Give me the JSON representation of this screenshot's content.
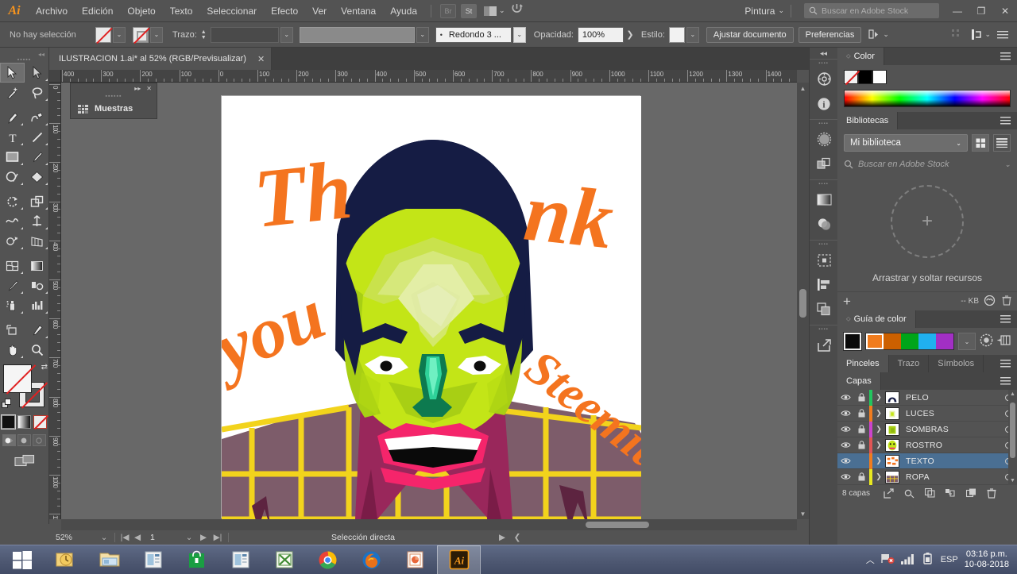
{
  "app": {
    "logo": "Ai",
    "menus": [
      "Archivo",
      "Edición",
      "Objeto",
      "Texto",
      "Seleccionar",
      "Efecto",
      "Ver",
      "Ventana",
      "Ayuda"
    ],
    "bridge_btn": "Br",
    "stock_btn": "St",
    "workspace": "Pintura",
    "stock_search_placeholder": "Buscar en Adobe Stock",
    "window_minimize": "—",
    "window_restore": "❐",
    "window_close": "✕"
  },
  "control_bar": {
    "selection_status": "No hay selección",
    "stroke_label": "Trazo:",
    "stroke_weight": "",
    "brush_definition": "Redondo 3 ...",
    "opacity_label": "Opacidad:",
    "opacity_value": "100%",
    "style_label": "Estilo:",
    "fit_document": "Ajustar documento",
    "preferences": "Preferencias"
  },
  "tools": {
    "items": [
      {
        "name": "selection-tool",
        "label": "Selección",
        "active": true
      },
      {
        "name": "direct-selection-tool",
        "label": "Selección directa",
        "active": false
      },
      {
        "name": "magic-wand-tool",
        "label": "Varita mágica",
        "active": false
      },
      {
        "name": "lasso-tool",
        "label": "Lazo",
        "active": false
      },
      {
        "name": "pen-tool",
        "label": "Pluma",
        "active": false
      },
      {
        "name": "curvature-tool",
        "label": "Curvatura",
        "active": false
      },
      {
        "name": "type-tool",
        "label": "Texto",
        "active": false
      },
      {
        "name": "line-segment-tool",
        "label": "Segmento de línea",
        "active": false
      },
      {
        "name": "rectangle-tool",
        "label": "Rectángulo",
        "active": false
      },
      {
        "name": "paintbrush-tool",
        "label": "Pincel",
        "active": false
      },
      {
        "name": "shaper-tool",
        "label": "Shaper",
        "active": false
      },
      {
        "name": "eraser-tool",
        "label": "Borrador",
        "active": false
      },
      {
        "name": "rotate-tool",
        "label": "Rotar",
        "active": false
      },
      {
        "name": "scale-tool",
        "label": "Escala",
        "active": false
      },
      {
        "name": "width-tool",
        "label": "Anchura",
        "active": false
      },
      {
        "name": "free-transform-tool",
        "label": "Transformación libre",
        "active": false
      },
      {
        "name": "shape-builder-tool",
        "label": "Creador de formas",
        "active": false
      },
      {
        "name": "perspective-grid-tool",
        "label": "Cuadrícula de perspectiva",
        "active": false
      },
      {
        "name": "mesh-tool",
        "label": "Malla",
        "active": false
      },
      {
        "name": "gradient-tool",
        "label": "Degradado",
        "active": false
      },
      {
        "name": "eyedropper-tool",
        "label": "Cuentagotas",
        "active": false
      },
      {
        "name": "blend-tool",
        "label": "Fusión",
        "active": false
      },
      {
        "name": "symbol-sprayer-tool",
        "label": "Rociar símbolos",
        "active": false
      },
      {
        "name": "column-graph-tool",
        "label": "Gráfica de columnas",
        "active": false
      },
      {
        "name": "artboard-tool",
        "label": "Mesa de trabajo",
        "active": false
      },
      {
        "name": "slice-tool",
        "label": "Sector",
        "active": false
      },
      {
        "name": "hand-tool",
        "label": "Mano",
        "active": false
      },
      {
        "name": "zoom-tool",
        "label": "Zoom",
        "active": false
      }
    ]
  },
  "document": {
    "tab_title": "ILUSTRACION 1.ai* al 52% (RGB/Previsualizar)",
    "tab_close": "✕",
    "ruler_h_ticks": [
      "400",
      "300",
      "200",
      "100",
      "0",
      "100",
      "200",
      "300",
      "400",
      "500",
      "600",
      "700",
      "800",
      "900",
      "1000",
      "1100",
      "1200",
      "1300",
      "1400"
    ],
    "ruler_v_ticks": [
      "0",
      "100",
      "200",
      "300",
      "400",
      "500",
      "600",
      "700",
      "800",
      "900",
      "1000",
      "1100"
    ]
  },
  "floating_panel": {
    "title": "Muestras",
    "expand": "▸▸",
    "close": "✕"
  },
  "status_bar": {
    "zoom": "52%",
    "page_number": "1",
    "tool_status": "Selección directa"
  },
  "panels": {
    "color": {
      "title": "Color",
      "swatch_none": "none",
      "swatch_black": "#000000",
      "swatch_white": "#ffffff"
    },
    "libraries": {
      "title": "Bibliotecas",
      "selected_library": "Mi biblioteca",
      "search_placeholder": "Buscar en Adobe Stock",
      "dropzone_text": "Arrastrar y soltar recursos",
      "size_label": "-- KB"
    },
    "color_guide": {
      "title": "Guía de color",
      "base_color": "#000000",
      "harmony": [
        "#f07c1e",
        "#cc6000",
        "#00a519",
        "#20b0ef",
        "#a22fc4"
      ]
    },
    "brush_tabs": {
      "tabs": [
        "Pinceles",
        "Trazo",
        "Símbolos"
      ],
      "active": "Pinceles"
    },
    "layers": {
      "title": "Capas",
      "rows": [
        {
          "name": "PELO",
          "color": "#22c55e",
          "visible": true,
          "locked": true,
          "selected": false
        },
        {
          "name": "LUCES",
          "color": "#f07c1e",
          "visible": true,
          "locked": true,
          "selected": false
        },
        {
          "name": "SOMBRAS",
          "color": "#cc44cc",
          "visible": true,
          "locked": true,
          "selected": false
        },
        {
          "name": "ROSTRO",
          "color": "#e05555",
          "visible": true,
          "locked": true,
          "selected": false
        },
        {
          "name": "TEXTO",
          "color": "#f07c1e",
          "visible": true,
          "locked": false,
          "selected": true
        },
        {
          "name": "ROPA",
          "color": "#e8e820",
          "visible": true,
          "locked": true,
          "selected": false
        }
      ],
      "count_label": "8 capas"
    }
  },
  "artwork": {
    "words": [
      {
        "text": "Th",
        "color": "#f4741f"
      },
      {
        "text": "nk",
        "color": "#f4741f"
      },
      {
        "text": "you",
        "color": "#f4741f"
      },
      {
        "text": "Steemit",
        "color": "#f4741f"
      }
    ],
    "colors": {
      "hair": "#151c44",
      "skin_light": "#d2e84f",
      "skin": "#c3e517",
      "skin_mid": "#a8cf14",
      "skin_shadow": "#8fb80f",
      "highlight": "#e9f0a8",
      "nose": "#0d7a4f",
      "nose_light": "#28c98b",
      "lips": "#f5256b",
      "mouth": "#000000",
      "shirt": "#7d5c6a",
      "collar": "#99275b",
      "grid": "#f2d31c",
      "background": "#ffffff"
    }
  },
  "taskbar": {
    "items": [
      {
        "name": "start-button",
        "label": "Inicio"
      },
      {
        "name": "taskbar-outlook",
        "label": "Outlook"
      },
      {
        "name": "taskbar-file-explorer",
        "label": "Explorador de archivos"
      },
      {
        "name": "taskbar-news",
        "label": "Noticias"
      },
      {
        "name": "taskbar-store",
        "label": "Tienda"
      },
      {
        "name": "taskbar-reader",
        "label": "Lector"
      },
      {
        "name": "taskbar-excel",
        "label": "Excel"
      },
      {
        "name": "taskbar-chrome",
        "label": "Google Chrome"
      },
      {
        "name": "taskbar-firefox",
        "label": "Mozilla Firefox"
      },
      {
        "name": "taskbar-powerpoint",
        "label": "PowerPoint"
      },
      {
        "name": "taskbar-illustrator",
        "label": "Adobe Illustrator",
        "active": true
      }
    ],
    "language": "ESP",
    "time": "03:16 p.m.",
    "date": "10-08-2018"
  }
}
